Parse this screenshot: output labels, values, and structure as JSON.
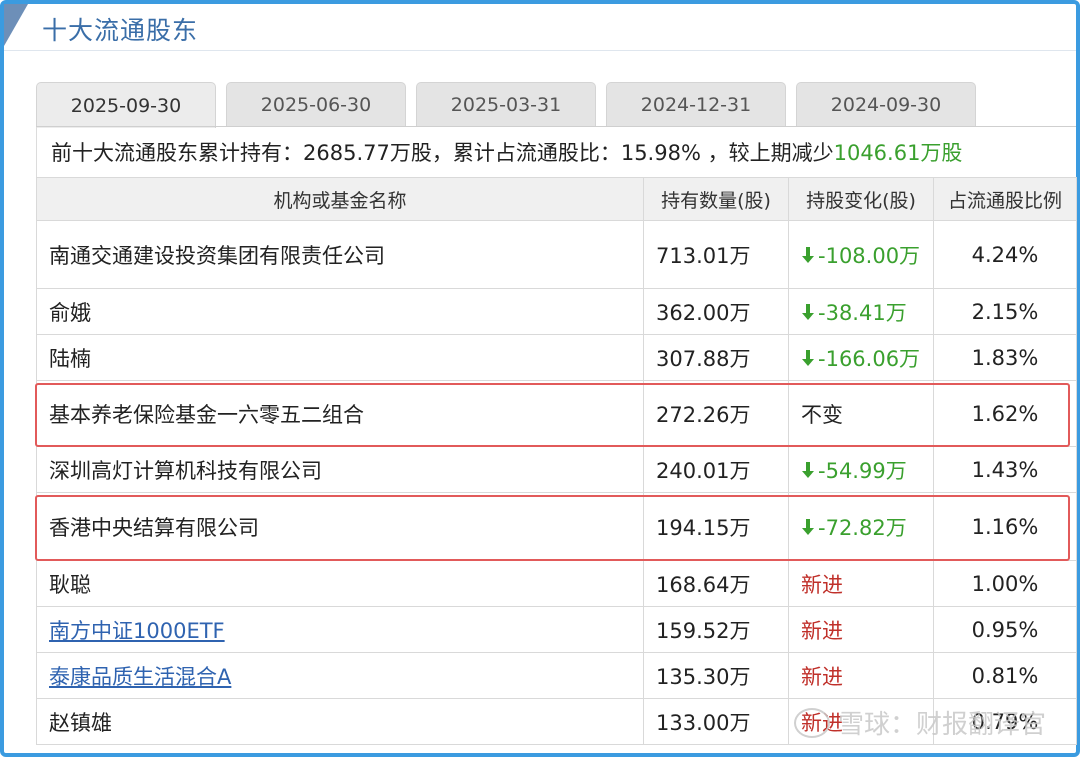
{
  "section_title": "十大流通股东",
  "tabs": [
    {
      "label": "2025-09-30",
      "active": true
    },
    {
      "label": "2025-06-30",
      "active": false
    },
    {
      "label": "2025-03-31",
      "active": false
    },
    {
      "label": "2024-12-31",
      "active": false
    },
    {
      "label": "2024-09-30",
      "active": false
    }
  ],
  "summary": {
    "prefix": "前十大流通股东累计持有：2685.77万股，累计占流通股比：15.98% ，较上期减少",
    "change": "1046.61万股"
  },
  "table": {
    "headers": [
      "机构或基金名称",
      "持有数量(股)",
      "持股变化(股)",
      "占流通股比例"
    ],
    "rows": [
      {
        "name": "南通交通建设投资集团有限责任公司",
        "qty": "713.01万",
        "change": "-108.00万",
        "change_type": "down",
        "ratio": "4.24%",
        "link": false
      },
      {
        "name": "俞娥",
        "qty": "362.00万",
        "change": "-38.41万",
        "change_type": "down",
        "ratio": "2.15%",
        "link": false
      },
      {
        "name": "陆楠",
        "qty": "307.88万",
        "change": "-166.06万",
        "change_type": "down",
        "ratio": "1.83%",
        "link": false
      },
      {
        "name": "基本养老保险基金一六零五二组合",
        "qty": "272.26万",
        "change": "不变",
        "change_type": "same",
        "ratio": "1.62%",
        "link": false
      },
      {
        "name": "深圳高灯计算机科技有限公司",
        "qty": "240.01万",
        "change": "-54.99万",
        "change_type": "down",
        "ratio": "1.43%",
        "link": false
      },
      {
        "name": "香港中央结算有限公司",
        "qty": "194.15万",
        "change": "-72.82万",
        "change_type": "down",
        "ratio": "1.16%",
        "link": false
      },
      {
        "name": "耿聪",
        "qty": "168.64万",
        "change": "新进",
        "change_type": "new",
        "ratio": "1.00%",
        "link": false
      },
      {
        "name": "南方中证1000ETF",
        "qty": "159.52万",
        "change": "新进",
        "change_type": "new",
        "ratio": "0.95%",
        "link": true
      },
      {
        "name": "泰康品质生活混合A",
        "qty": "135.30万",
        "change": "新进",
        "change_type": "new",
        "ratio": "0.81%",
        "link": true
      },
      {
        "name": "赵镇雄",
        "qty": "133.00万",
        "change": "新进",
        "change_type": "new",
        "ratio": "0.79%",
        "link": false
      }
    ]
  },
  "watermark": "雪球：财报翻译官",
  "colors": {
    "accent_blue": "#3b9be0",
    "title_blue": "#3a6ea8",
    "down_green": "#3aa02e",
    "new_red": "#c0302a",
    "highlight_red": "#e25a5a"
  }
}
